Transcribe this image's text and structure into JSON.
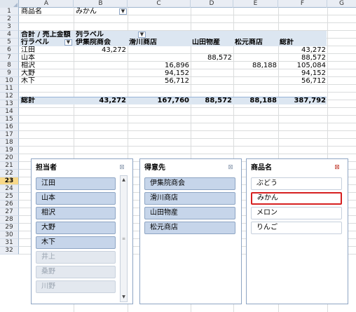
{
  "columns": [
    "A",
    "B",
    "C",
    "D",
    "E",
    "F",
    "G"
  ],
  "rows": [
    "1",
    "2",
    "3",
    "4",
    "5",
    "6",
    "7",
    "8",
    "9",
    "10",
    "11",
    "12",
    "13",
    "14",
    "15",
    "16",
    "17",
    "18",
    "19",
    "20",
    "21",
    "22",
    "23",
    "24",
    "25",
    "26",
    "27",
    "28",
    "29",
    "30",
    "31",
    "32"
  ],
  "active_row": "23",
  "filter": {
    "label": "商品名",
    "value": "みかん"
  },
  "pivot": {
    "value_label": "合計 / 売上金額",
    "col_label": "列ラベル",
    "row_label": "行ラベル",
    "headers": [
      "伊集院商会",
      "滑川商店",
      "山田物産",
      "松元商店",
      "総計"
    ],
    "rows": [
      {
        "name": "江田",
        "values": [
          "43,272",
          "",
          "",
          "",
          "43,272"
        ]
      },
      {
        "name": "山本",
        "values": [
          "",
          "",
          "88,572",
          "",
          "88,572"
        ]
      },
      {
        "name": "相沢",
        "values": [
          "",
          "16,896",
          "",
          "88,188",
          "105,084"
        ]
      },
      {
        "name": "大野",
        "values": [
          "",
          "94,152",
          "",
          "",
          "94,152"
        ]
      },
      {
        "name": "木下",
        "values": [
          "",
          "56,712",
          "",
          "",
          "56,712"
        ]
      }
    ],
    "total": {
      "name": "総計",
      "values": [
        "43,272",
        "167,760",
        "88,572",
        "88,188",
        "387,792"
      ]
    }
  },
  "slicers": {
    "tanto": {
      "title": "担当者",
      "items": [
        "江田",
        "山本",
        "相沢",
        "大野",
        "木下",
        "井上",
        "桑野",
        "川野"
      ],
      "available": [
        true,
        true,
        true,
        true,
        true,
        false,
        false,
        false
      ]
    },
    "tokui": {
      "title": "得意先",
      "items": [
        "伊集院商会",
        "滑川商店",
        "山田物産",
        "松元商店"
      ]
    },
    "shohin": {
      "title": "商品名",
      "items": [
        "ぶどう",
        "みかん",
        "メロン",
        "りんご"
      ],
      "selected": "みかん"
    }
  },
  "icons": {
    "filter_active": "funnel-filter-icon",
    "dropdown": "chevron-down-icon",
    "clear_filter": "clear-filter-icon",
    "scroll_up": "scroll-up-icon",
    "scroll_down": "scroll-down-icon"
  },
  "colors": {
    "selection_outline": "#d62020",
    "slicer_item": "#c6d5ea",
    "pivot_band": "#dce6f1"
  }
}
